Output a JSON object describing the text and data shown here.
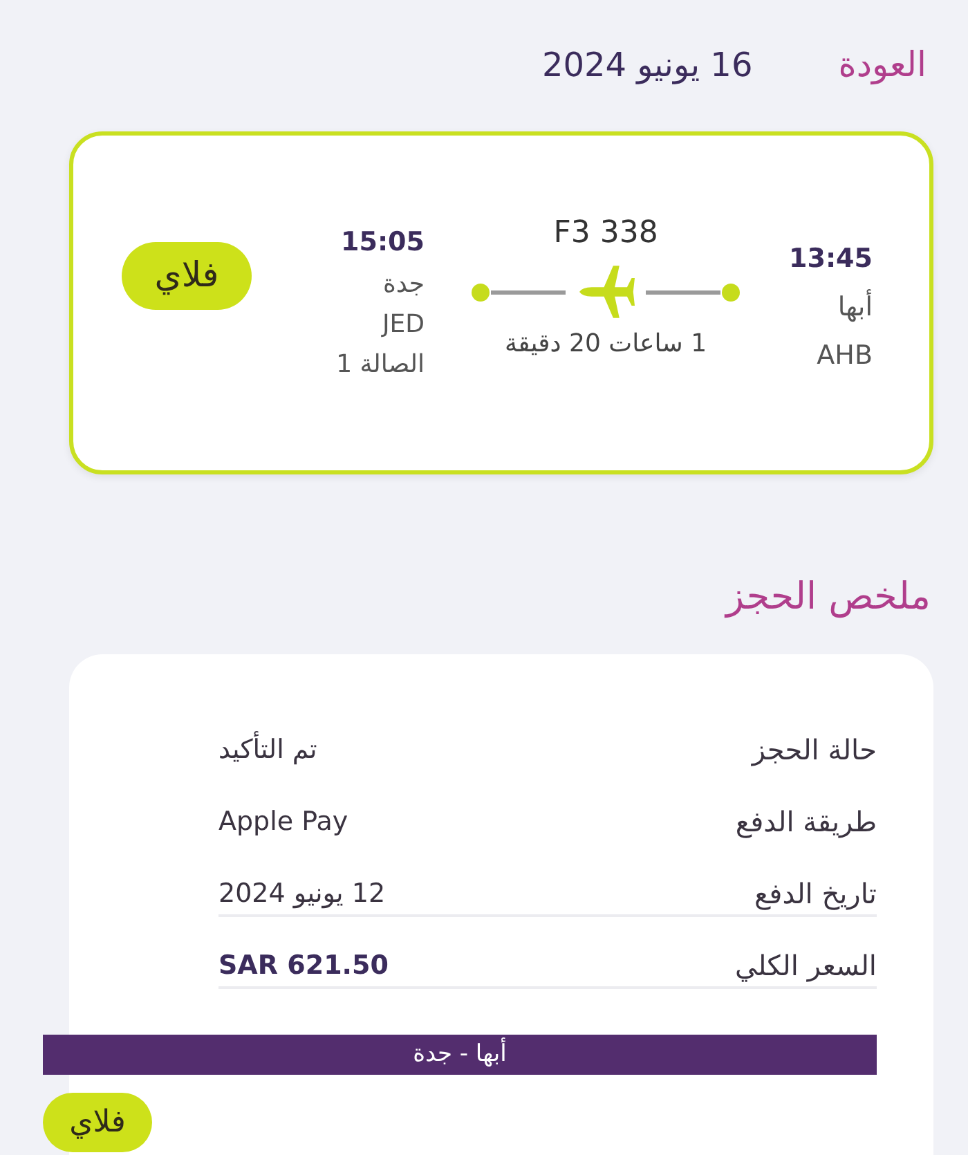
{
  "return_header": {
    "label": "العودة",
    "date": "16 يونيو 2024"
  },
  "flight_card": {
    "departure": {
      "time": "13:45",
      "city": "أبها",
      "code": "AHB"
    },
    "flight_number": "F3 338",
    "duration": "1 ساعات 20 دقيقة",
    "arrival": {
      "time": "15:05",
      "city": "جدة",
      "code": "JED",
      "terminal": "الصالة 1"
    },
    "airline_badge": "فلاي"
  },
  "booking_summary": {
    "title": "ملخص الحجز",
    "rows": [
      {
        "label": "حالة الحجز",
        "value": "تم التأكيد",
        "kind": "text",
        "underlined": false
      },
      {
        "label": "طريقة الدفع",
        "value": "Apple Pay",
        "kind": "text",
        "underlined": false
      },
      {
        "label": "تاريخ الدفع",
        "value": "12 يونيو 2024",
        "kind": "text",
        "underlined": true
      },
      {
        "label": "السعر الكلي",
        "value": "SAR 621.50",
        "kind": "total",
        "underlined": true
      }
    ],
    "route_bar": "أبها - جدة",
    "airline_badge": "فلاي"
  }
}
